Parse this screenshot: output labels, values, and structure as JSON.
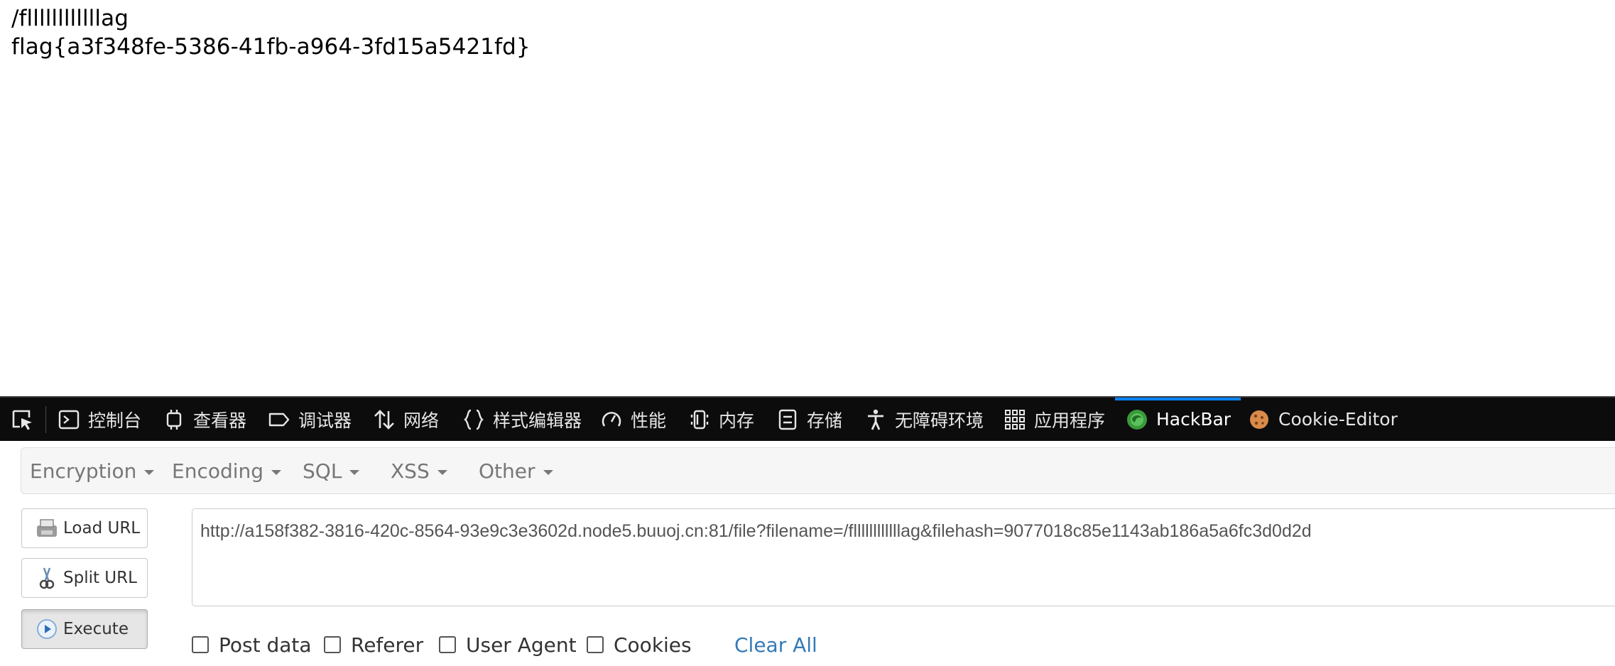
{
  "page": {
    "lines": [
      "/fllllllllllllag",
      "flag{a3f348fe-5386-41fb-a964-3fd15a5421fd}"
    ]
  },
  "devtools": {
    "tabs": [
      {
        "label": "控制台",
        "icon": "console-icon"
      },
      {
        "label": "查看器",
        "icon": "inspector-icon"
      },
      {
        "label": "调试器",
        "icon": "debugger-icon"
      },
      {
        "label": "网络",
        "icon": "network-icon"
      },
      {
        "label": "样式编辑器",
        "icon": "style-editor-icon"
      },
      {
        "label": "性能",
        "icon": "performance-icon"
      },
      {
        "label": "内存",
        "icon": "memory-icon"
      },
      {
        "label": "存储",
        "icon": "storage-icon"
      },
      {
        "label": "无障碍环境",
        "icon": "accessibility-icon"
      },
      {
        "label": "应用程序",
        "icon": "application-icon"
      },
      {
        "label": "HackBar",
        "icon": "hackbar-icon",
        "active": true
      },
      {
        "label": "Cookie-Editor",
        "icon": "cookie-icon"
      }
    ],
    "accent_color": "#0a84ff"
  },
  "hackbar": {
    "menus": [
      "Encryption",
      "Encoding",
      "SQL",
      "XSS",
      "Other"
    ],
    "buttons": {
      "load_url": "Load URL",
      "split_url": "Split URL",
      "execute": "Execute"
    },
    "url": "http://a158f382-3816-420c-8564-93e9c3e3602d.node5.buuoj.cn:81/file?filename=/fllllllllllllag&filehash=9077018c85e1143ab186a5a6fc3d0d2d",
    "options": [
      "Post data",
      "Referer",
      "User Agent",
      "Cookies"
    ],
    "clear_all": "Clear All",
    "link_color": "#337ab7"
  }
}
